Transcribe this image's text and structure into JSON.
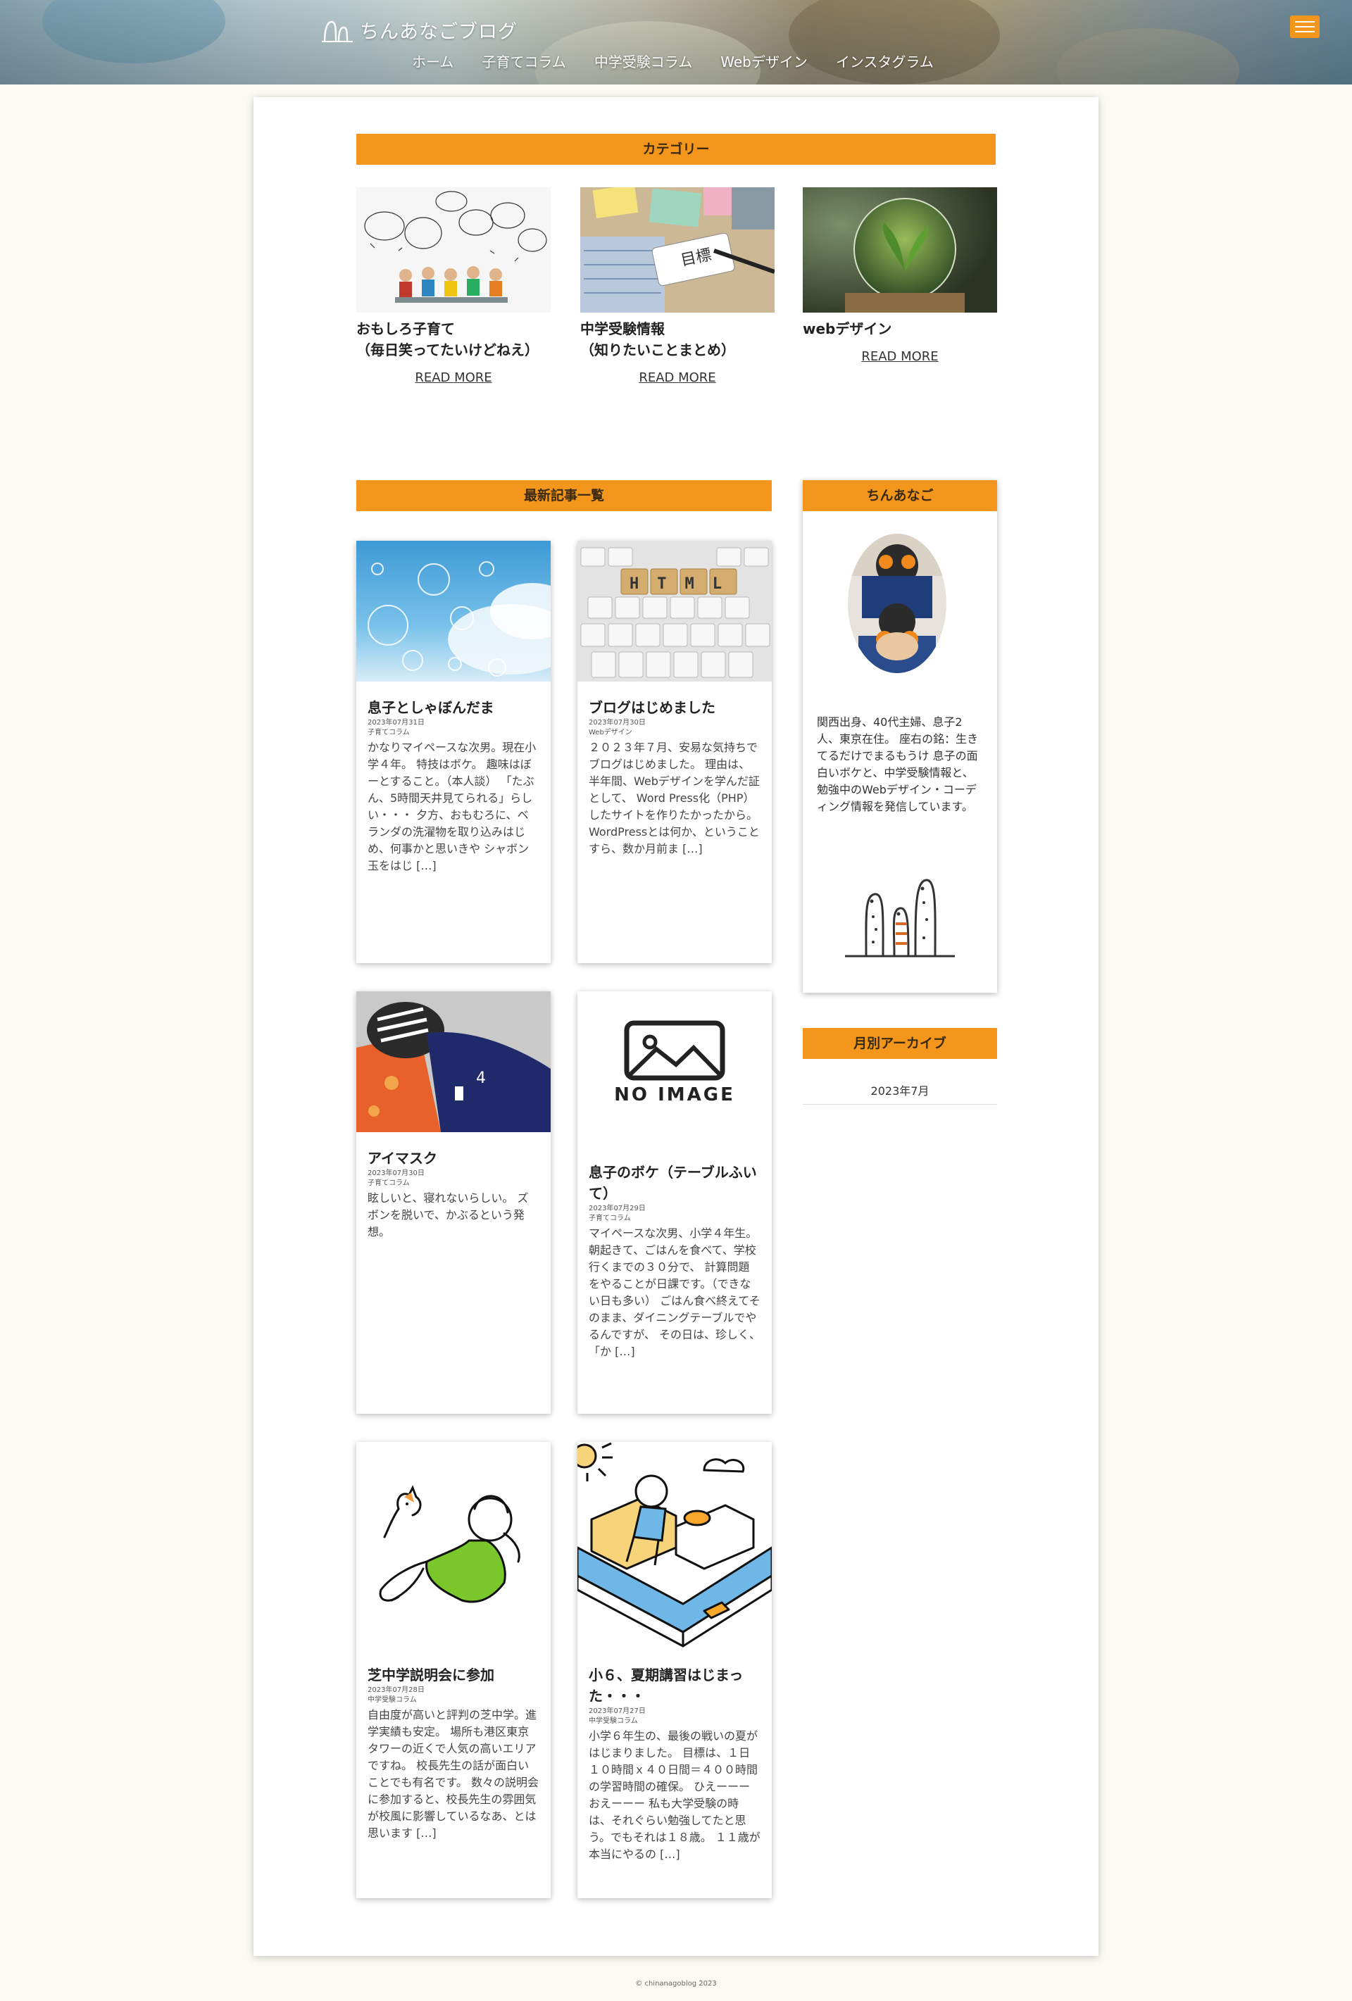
{
  "site": {
    "logo_text": "ちんあなごブログ",
    "nav": [
      "ホーム",
      "子育てコラム",
      "中学受験コラム",
      "Webデザイン",
      "インスタグラム"
    ],
    "accent": "#f4961c"
  },
  "categories": {
    "heading": "カテゴリー",
    "items": [
      {
        "title_line1": "おもしろ子育て",
        "title_line2": "（毎日笑ってたいけどねえ）",
        "more": "READ MORE",
        "thumb_text": ""
      },
      {
        "title_line1": "中学受験情報",
        "title_line2": "（知りたいことまとめ）",
        "more": "READ MORE",
        "thumb_text": "目標"
      },
      {
        "title_line1": "webデザイン",
        "title_line2": "",
        "more": "READ MORE",
        "thumb_text": ""
      }
    ]
  },
  "latest": {
    "heading": "最新記事一覧",
    "posts": [
      {
        "title": "息子としゃぼんだま",
        "date": "2023年07月31日",
        "category": "子育てコラム",
        "excerpt": "かなりマイペースな次男。現在小学４年。 特技はボケ。 趣味はぼーとすること。（本人談） 「たぶん、5時間天井見てられる」らしい・・・ 夕方、おもむろに、ベランダの洗濯物を取り込みはじめ、何事かと思いきや シャボン玉をはじ […]"
      },
      {
        "title": "ブログはじめました",
        "date": "2023年07月30日",
        "category": "Webデザイン",
        "excerpt": "２０２３年７月、安易な気持ちでブログはじめました。 理由は、半年間、Webデザインを学んだ証として、 Word Press化（PHP）したサイトを作りたかったから。 WordPressとは何か、ということすら、数か月前ま […]",
        "thumb_text": "HTML"
      },
      {
        "title": "アイマスク",
        "date": "2023年07月30日",
        "category": "子育てコラム",
        "excerpt": "眩しいと、寝れないらしい。 ズボンを脱いで、かぶるという発想。",
        "thumb_text": "4"
      },
      {
        "title": "息子のボケ（テーブルふいて）",
        "date": "2023年07月29日",
        "category": "子育てコラム",
        "excerpt": "マイペースな次男、小学４年生。 朝起きて、ごはんを食べて、学校行くまでの３０分で、 計算問題をやることが日課です。（できない日も多い） ごはん食べ終えてそのまま、ダイニングテーブルでやるんですが、 その日は、珍しく、「か […]",
        "thumb_text": "NO IMAGE"
      },
      {
        "title": "芝中学説明会に参加",
        "date": "2023年07月28日",
        "category": "中学受験コラム",
        "excerpt": "自由度が高いと評判の芝中学。進学実績も安定。 場所も港区東京タワーの近くで人気の高いエリアですね。 校長先生の話が面白いことでも有名です。 数々の説明会に参加すると、校長先生の雰囲気が校風に影響しているなあ、とは思います […]"
      },
      {
        "title": "小６、夏期講習はじまった・・・",
        "date": "2023年07月27日",
        "category": "中学受験コラム",
        "excerpt": "小学６年生の、最後の戦いの夏がはじまりました。 目標は、１日１０時間ｘ４０日間＝４００時間の学習時間の確保。 ひえーーーおえーーー 私も大学受験の時は、それぐらい勉強してたと思う。でもそれは１８歳。 １１歳が本当にやるの […]"
      }
    ]
  },
  "sidebar": {
    "profile_heading": "ちんあなご",
    "bio": "関西出身、40代主婦、息子2人、東京在住。 座右の銘：生きてるだけでまるもうけ 息子の面白いボケと、中学受験情報と、勉強中のWebデザイン・コーディング情報を発信しています。",
    "archive_heading": "月別アーカイブ",
    "archive_month": "2023年7月"
  },
  "footer": {
    "copyright": "© chinanagoblog 2023"
  }
}
